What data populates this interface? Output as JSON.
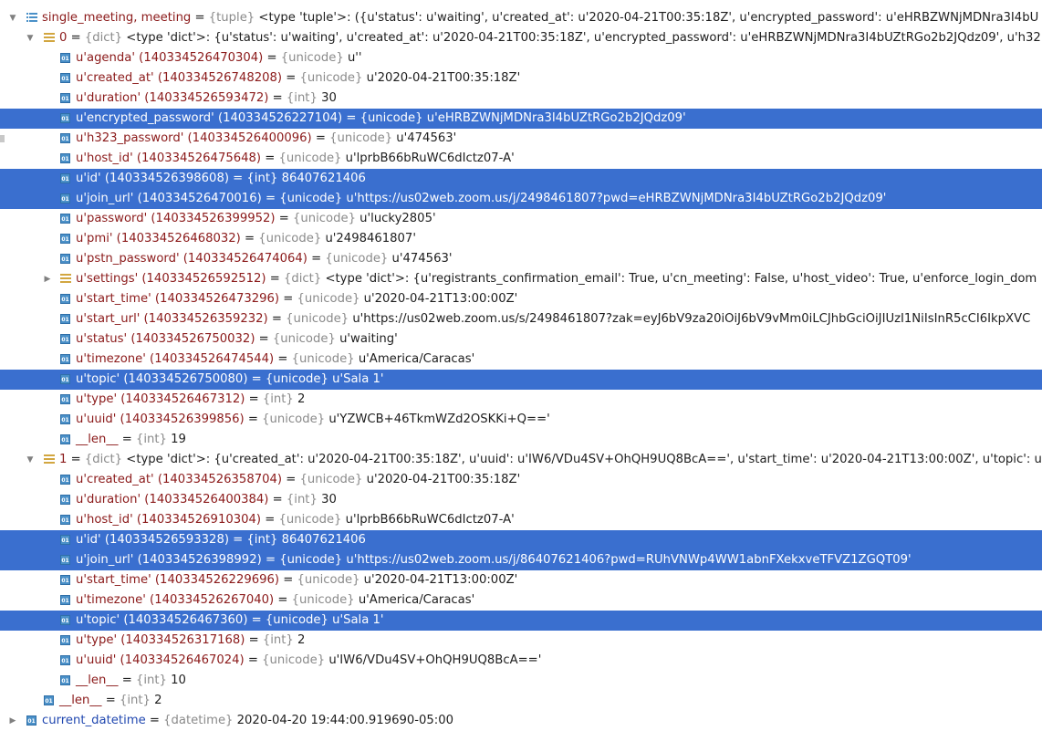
{
  "variables_tree": [
    {
      "name": "single_meeting, meeting",
      "type": "{tuple}",
      "value": "<type 'tuple'>: ({u'status': u'waiting', u'created_at': u'2020-04-21T00:35:18Z', u'encrypted_password': u'eHRBZWNjMDNra3I4bU",
      "indent": 0,
      "arrow": "down",
      "icon": "tuple",
      "blue": false,
      "selected": false
    },
    {
      "name": "0",
      "type": "{dict}",
      "value": "<type 'dict'>: {u'status': u'waiting', u'created_at': u'2020-04-21T00:35:18Z', u'encrypted_password': u'eHRBZWNjMDNra3I4bUZtRGo2b2JQdz09', u'h32",
      "indent": 1,
      "arrow": "down",
      "icon": "dict",
      "blue": false,
      "selected": false
    },
    {
      "name": "u'agenda' (140334526470304)",
      "type": "{unicode}",
      "value": "u''",
      "indent": 2,
      "arrow": "",
      "icon": "value",
      "blue": false,
      "selected": false
    },
    {
      "name": "u'created_at' (140334526748208)",
      "type": "{unicode}",
      "value": "u'2020-04-21T00:35:18Z'",
      "indent": 2,
      "arrow": "",
      "icon": "value",
      "blue": false,
      "selected": false
    },
    {
      "name": "u'duration' (140334526593472)",
      "type": "{int}",
      "value": "30",
      "indent": 2,
      "arrow": "",
      "icon": "value",
      "blue": false,
      "selected": false
    },
    {
      "name": "u'encrypted_password' (140334526227104)",
      "type": "{unicode}",
      "value": "u'eHRBZWNjMDNra3I4bUZtRGo2b2JQdz09'",
      "indent": 2,
      "arrow": "",
      "icon": "value",
      "blue": false,
      "selected": true
    },
    {
      "name": "u'h323_password' (140334526400096)",
      "type": "{unicode}",
      "value": "u'474563'",
      "indent": 2,
      "arrow": "",
      "icon": "value",
      "blue": false,
      "selected": false
    },
    {
      "name": "u'host_id' (140334526475648)",
      "type": "{unicode}",
      "value": "u'lprbB66bRuWC6dIctz07-A'",
      "indent": 2,
      "arrow": "",
      "icon": "value",
      "blue": false,
      "selected": false
    },
    {
      "name": "u'id' (140334526398608)",
      "type": "{int}",
      "value": "86407621406",
      "indent": 2,
      "arrow": "",
      "icon": "value",
      "blue": false,
      "selected": true
    },
    {
      "name": "u'join_url' (140334526470016)",
      "type": "{unicode}",
      "value": "u'https://us02web.zoom.us/j/2498461807?pwd=eHRBZWNjMDNra3I4bUZtRGo2b2JQdz09'",
      "indent": 2,
      "arrow": "",
      "icon": "value",
      "blue": false,
      "selected": true
    },
    {
      "name": "u'password' (140334526399952)",
      "type": "{unicode}",
      "value": "u'lucky2805'",
      "indent": 2,
      "arrow": "",
      "icon": "value",
      "blue": false,
      "selected": false
    },
    {
      "name": "u'pmi' (140334526468032)",
      "type": "{unicode}",
      "value": "u'2498461807'",
      "indent": 2,
      "arrow": "",
      "icon": "value",
      "blue": false,
      "selected": false
    },
    {
      "name": "u'pstn_password' (140334526474064)",
      "type": "{unicode}",
      "value": "u'474563'",
      "indent": 2,
      "arrow": "",
      "icon": "value",
      "blue": false,
      "selected": false
    },
    {
      "name": "u'settings' (140334526592512)",
      "type": "{dict}",
      "value": "<type 'dict'>: {u'registrants_confirmation_email': True, u'cn_meeting': False, u'host_video': True, u'enforce_login_dom",
      "indent": 2,
      "arrow": "right",
      "icon": "dict",
      "blue": false,
      "selected": false
    },
    {
      "name": "u'start_time' (140334526473296)",
      "type": "{unicode}",
      "value": "u'2020-04-21T13:00:00Z'",
      "indent": 2,
      "arrow": "",
      "icon": "value",
      "blue": false,
      "selected": false
    },
    {
      "name": "u'start_url' (140334526359232)",
      "type": "{unicode}",
      "value": "u'https://us02web.zoom.us/s/2498461807?zak=eyJ6bV9za20iOiJ6bV9vMm0iLCJhbGciOiJIUzI1NiIsInR5cCI6IkpXVC",
      "indent": 2,
      "arrow": "",
      "icon": "value",
      "blue": false,
      "selected": false
    },
    {
      "name": "u'status' (140334526750032)",
      "type": "{unicode}",
      "value": "u'waiting'",
      "indent": 2,
      "arrow": "",
      "icon": "value",
      "blue": false,
      "selected": false
    },
    {
      "name": "u'timezone' (140334526474544)",
      "type": "{unicode}",
      "value": "u'America/Caracas'",
      "indent": 2,
      "arrow": "",
      "icon": "value",
      "blue": false,
      "selected": false
    },
    {
      "name": "u'topic' (140334526750080)",
      "type": "{unicode}",
      "value": "u'Sala 1'",
      "indent": 2,
      "arrow": "",
      "icon": "value",
      "blue": false,
      "selected": true
    },
    {
      "name": "u'type' (140334526467312)",
      "type": "{int}",
      "value": "2",
      "indent": 2,
      "arrow": "",
      "icon": "value",
      "blue": false,
      "selected": false
    },
    {
      "name": "u'uuid' (140334526399856)",
      "type": "{unicode}",
      "value": "u'YZWCB+46TkmWZd2OSKKi+Q=='",
      "indent": 2,
      "arrow": "",
      "icon": "value",
      "blue": false,
      "selected": false
    },
    {
      "name": "__len__",
      "type": "{int}",
      "value": "19",
      "indent": 2,
      "arrow": "",
      "icon": "value",
      "blue": false,
      "selected": false
    },
    {
      "name": "1",
      "type": "{dict}",
      "value": "<type 'dict'>: {u'created_at': u'2020-04-21T00:35:18Z', u'uuid': u'IW6/VDu4SV+OhQH9UQ8BcA==', u'start_time': u'2020-04-21T13:00:00Z', u'topic': u'Sal",
      "indent": 1,
      "arrow": "down",
      "icon": "dict",
      "blue": false,
      "selected": false
    },
    {
      "name": "u'created_at' (140334526358704)",
      "type": "{unicode}",
      "value": "u'2020-04-21T00:35:18Z'",
      "indent": 2,
      "arrow": "",
      "icon": "value",
      "blue": false,
      "selected": false
    },
    {
      "name": "u'duration' (140334526400384)",
      "type": "{int}",
      "value": "30",
      "indent": 2,
      "arrow": "",
      "icon": "value",
      "blue": false,
      "selected": false
    },
    {
      "name": "u'host_id' (140334526910304)",
      "type": "{unicode}",
      "value": "u'lprbB66bRuWC6dIctz07-A'",
      "indent": 2,
      "arrow": "",
      "icon": "value",
      "blue": false,
      "selected": false
    },
    {
      "name": "u'id' (140334526593328)",
      "type": "{int}",
      "value": "86407621406",
      "indent": 2,
      "arrow": "",
      "icon": "value",
      "blue": false,
      "selected": true
    },
    {
      "name": "u'join_url' (140334526398992)",
      "type": "{unicode}",
      "value": "u'https://us02web.zoom.us/j/86407621406?pwd=RUhVNWp4WW1abnFXekxveTFVZ1ZGQT09'",
      "indent": 2,
      "arrow": "",
      "icon": "value",
      "blue": false,
      "selected": true
    },
    {
      "name": "u'start_time' (140334526229696)",
      "type": "{unicode}",
      "value": "u'2020-04-21T13:00:00Z'",
      "indent": 2,
      "arrow": "",
      "icon": "value",
      "blue": false,
      "selected": false
    },
    {
      "name": "u'timezone' (140334526267040)",
      "type": "{unicode}",
      "value": "u'America/Caracas'",
      "indent": 2,
      "arrow": "",
      "icon": "value",
      "blue": false,
      "selected": false
    },
    {
      "name": "u'topic' (140334526467360)",
      "type": "{unicode}",
      "value": "u'Sala 1'",
      "indent": 2,
      "arrow": "",
      "icon": "value",
      "blue": false,
      "selected": true
    },
    {
      "name": "u'type' (140334526317168)",
      "type": "{int}",
      "value": "2",
      "indent": 2,
      "arrow": "",
      "icon": "value",
      "blue": false,
      "selected": false
    },
    {
      "name": "u'uuid' (140334526467024)",
      "type": "{unicode}",
      "value": "u'IW6/VDu4SV+OhQH9UQ8BcA=='",
      "indent": 2,
      "arrow": "",
      "icon": "value",
      "blue": false,
      "selected": false
    },
    {
      "name": "__len__",
      "type": "{int}",
      "value": "10",
      "indent": 2,
      "arrow": "",
      "icon": "value",
      "blue": false,
      "selected": false
    },
    {
      "name": "__len__",
      "type": "{int}",
      "value": "2",
      "indent": 1,
      "arrow": "",
      "icon": "value",
      "blue": false,
      "selected": false
    },
    {
      "name": "current_datetime",
      "type": "{datetime}",
      "value": "2020-04-20 19:44:00.919690-05:00",
      "indent": 0,
      "arrow": "right",
      "icon": "value",
      "blue": true,
      "selected": false
    }
  ],
  "icon_labels": {
    "value": "01"
  },
  "colors": {
    "selection": "#3a6fcf",
    "name": "#8b1a1a",
    "name_blue": "#2148b0",
    "type": "#8a8a8a",
    "value_icon": "#4a90c8",
    "dict_icon": "#d2a640"
  }
}
